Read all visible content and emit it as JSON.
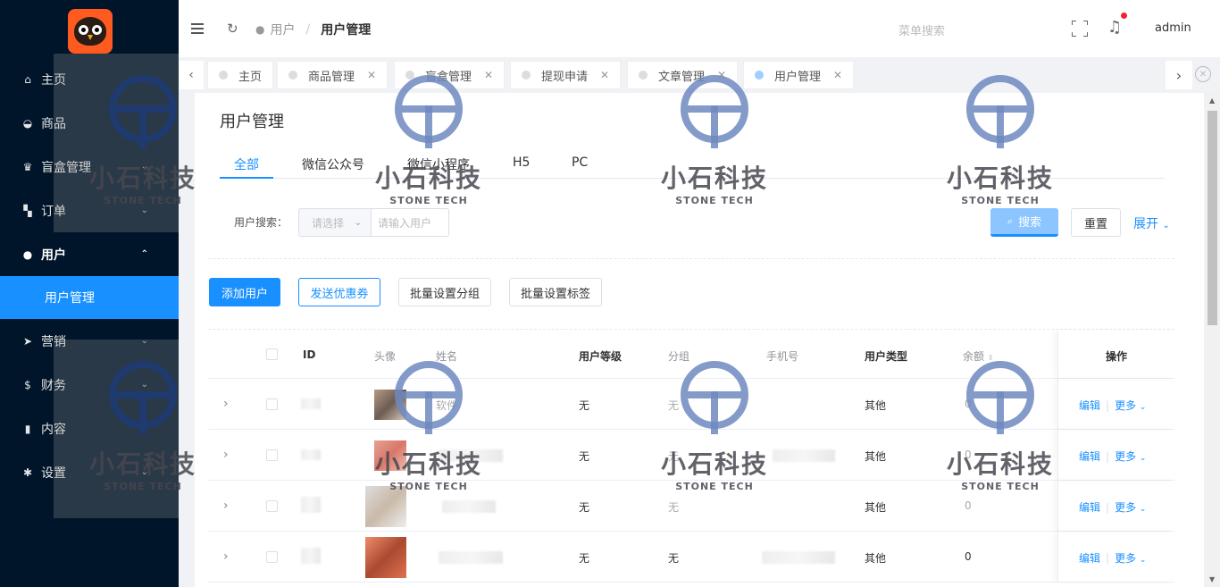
{
  "sidebar": {
    "items": [
      {
        "label": "主页",
        "icon": "home-icon"
      },
      {
        "label": "商品",
        "icon": "basket-icon"
      },
      {
        "label": "盲盒管理",
        "icon": "trophy-icon"
      },
      {
        "label": "订单",
        "icon": "cart-icon"
      },
      {
        "label": "用户",
        "icon": "user-icon"
      },
      {
        "label": "营销",
        "icon": "send-icon"
      },
      {
        "label": "财务",
        "icon": "dollar-icon"
      },
      {
        "label": "内容",
        "icon": "book-icon"
      },
      {
        "label": "设置",
        "icon": "gear-icon"
      }
    ],
    "active_sub": "用户管理"
  },
  "header": {
    "breadcrumb_parent": "用户",
    "breadcrumb_current": "用户管理",
    "menu_search_placeholder": "菜单搜索",
    "username": "admin"
  },
  "tabs": [
    {
      "label": "主页",
      "closable": false
    },
    {
      "label": "商品管理",
      "closable": true
    },
    {
      "label": "盲盒管理",
      "closable": true
    },
    {
      "label": "提现申请",
      "closable": true
    },
    {
      "label": "文章管理",
      "closable": true
    },
    {
      "label": "用户管理",
      "closable": true,
      "active": true
    }
  ],
  "page": {
    "title": "用户管理",
    "subtabs": [
      "全部",
      "微信公众号",
      "微信小程序",
      "H5",
      "PC"
    ]
  },
  "search": {
    "label": "用户搜索：",
    "select_placeholder": "请选择",
    "input_placeholder": "请输入用户",
    "search_button": "搜索",
    "reset_button": "重置",
    "expand_link": "展开"
  },
  "actions": {
    "add_user": "添加用户",
    "send_coupon": "发送优惠券",
    "batch_group": "批量设置分组",
    "batch_tag": "批量设置标签"
  },
  "table": {
    "columns": {
      "id": "ID",
      "avatar": "头像",
      "name": "姓名",
      "level": "用户等级",
      "group": "分组",
      "phone": "手机号",
      "type": "用户类型",
      "balance": "余额",
      "ops": "操作"
    },
    "rows": [
      {
        "name": "软件",
        "level": "无",
        "group": "无",
        "type": "其他",
        "balance": "0"
      },
      {
        "name": "",
        "level": "无",
        "group": "无",
        "type": "其他",
        "balance": "0"
      },
      {
        "name": "",
        "level": "无",
        "group": "无",
        "type": "其他",
        "balance": "0"
      },
      {
        "name": "",
        "level": "无",
        "group": "无",
        "type": "其他",
        "balance": "0"
      }
    ],
    "edit_label": "编辑",
    "more_label": "更多"
  },
  "watermark": {
    "cn": "小石科技",
    "en": "STONE TECH"
  },
  "colors": {
    "primary": "#1890ff",
    "sidebar": "#001529",
    "logo": "#ff5a1f"
  }
}
